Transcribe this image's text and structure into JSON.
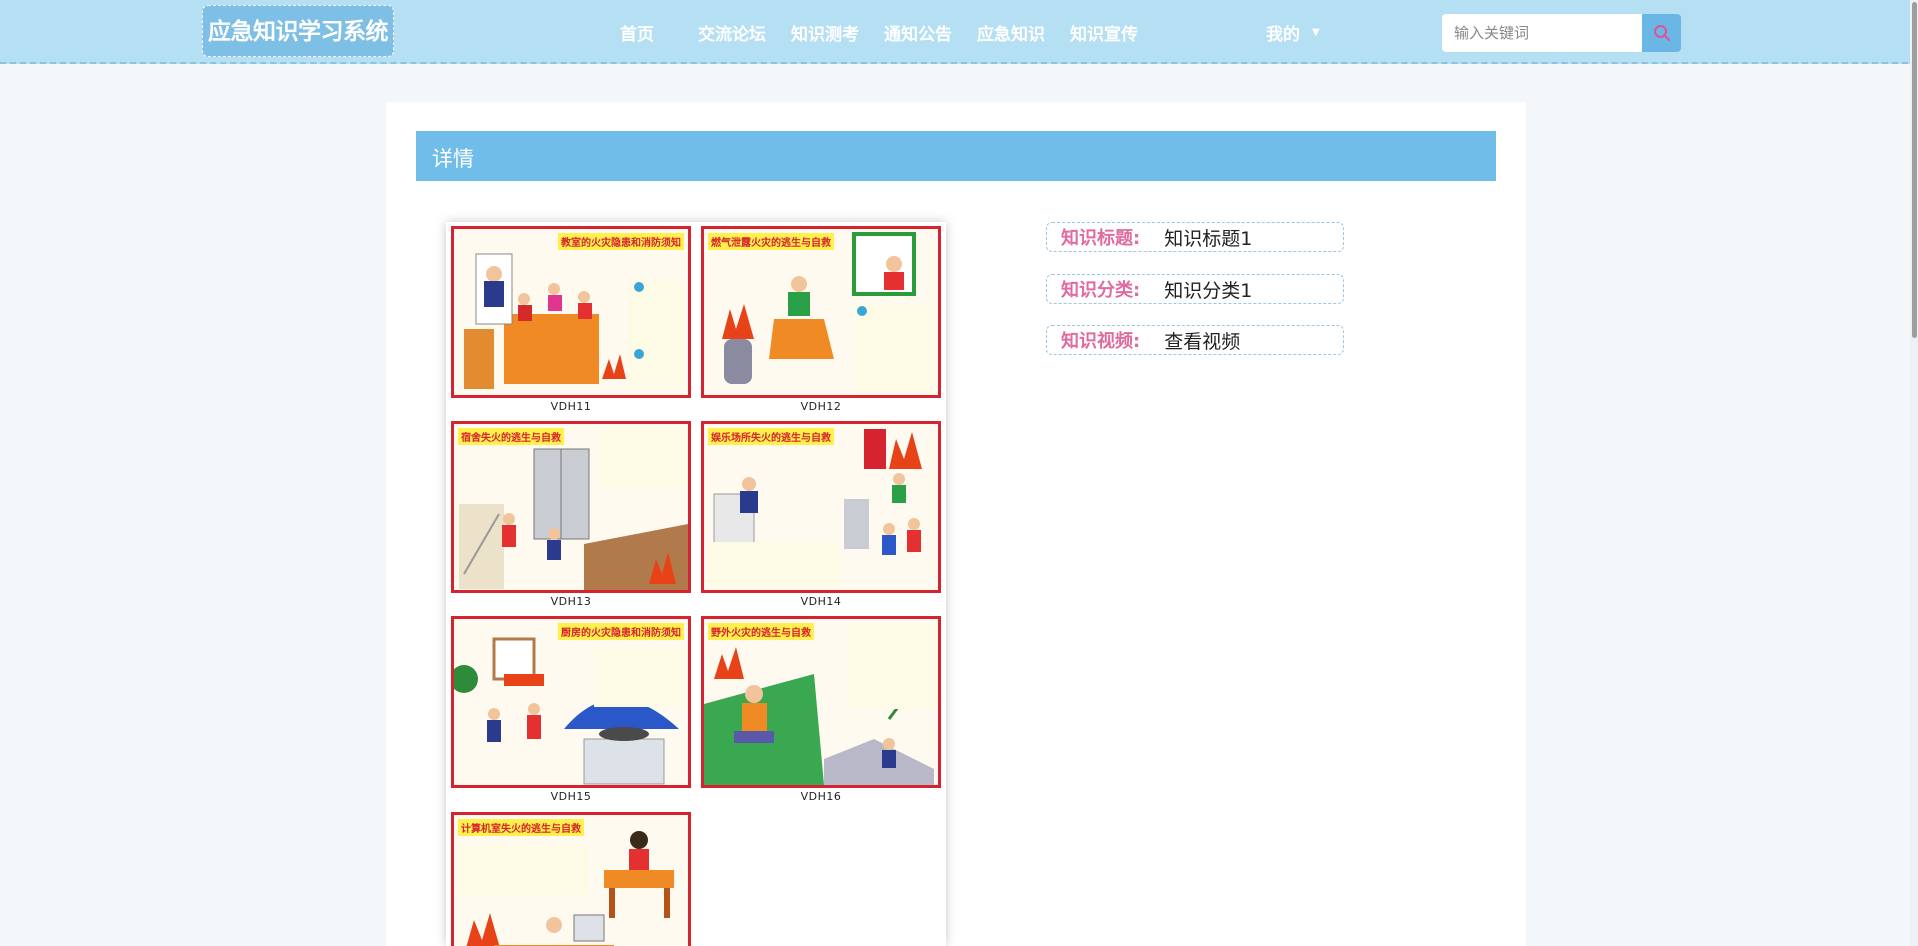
{
  "header": {
    "logo": "应急知识学习系统",
    "nav": [
      "首页",
      "交流论坛",
      "知识测考",
      "通知公告",
      "应急知识",
      "知识宣传"
    ],
    "user_menu": "我的",
    "search_placeholder": "输入关键词"
  },
  "detail": {
    "section_title": "详情",
    "fields": [
      {
        "label": "知识标题:",
        "value": "知识标题1"
      },
      {
        "label": "知识分类:",
        "value": "知识分类1"
      },
      {
        "label": "知识视频:",
        "value": "查看视频"
      }
    ]
  },
  "poster": {
    "panels": [
      {
        "title": "教室的火灾隐患和消防须知",
        "code": "VDH11"
      },
      {
        "title": "燃气泄露火灾的逃生与自救",
        "code": "VDH12"
      },
      {
        "title": "宿舍失火的逃生与自救",
        "code": "VDH13"
      },
      {
        "title": "娱乐场所失火的逃生与自救",
        "code": "VDH14"
      },
      {
        "title": "厨房的火灾隐患和消防须知",
        "code": "VDH15"
      },
      {
        "title": "野外火灾的逃生与自救",
        "code": "VDH16"
      },
      {
        "title": "计算机室失火的逃生与自救",
        "code": ""
      }
    ]
  },
  "colors": {
    "header_bg": "#b5dff3",
    "accent_blue": "#71bdea",
    "label_pink": "#e06ba0",
    "poster_red": "#d5232f"
  }
}
